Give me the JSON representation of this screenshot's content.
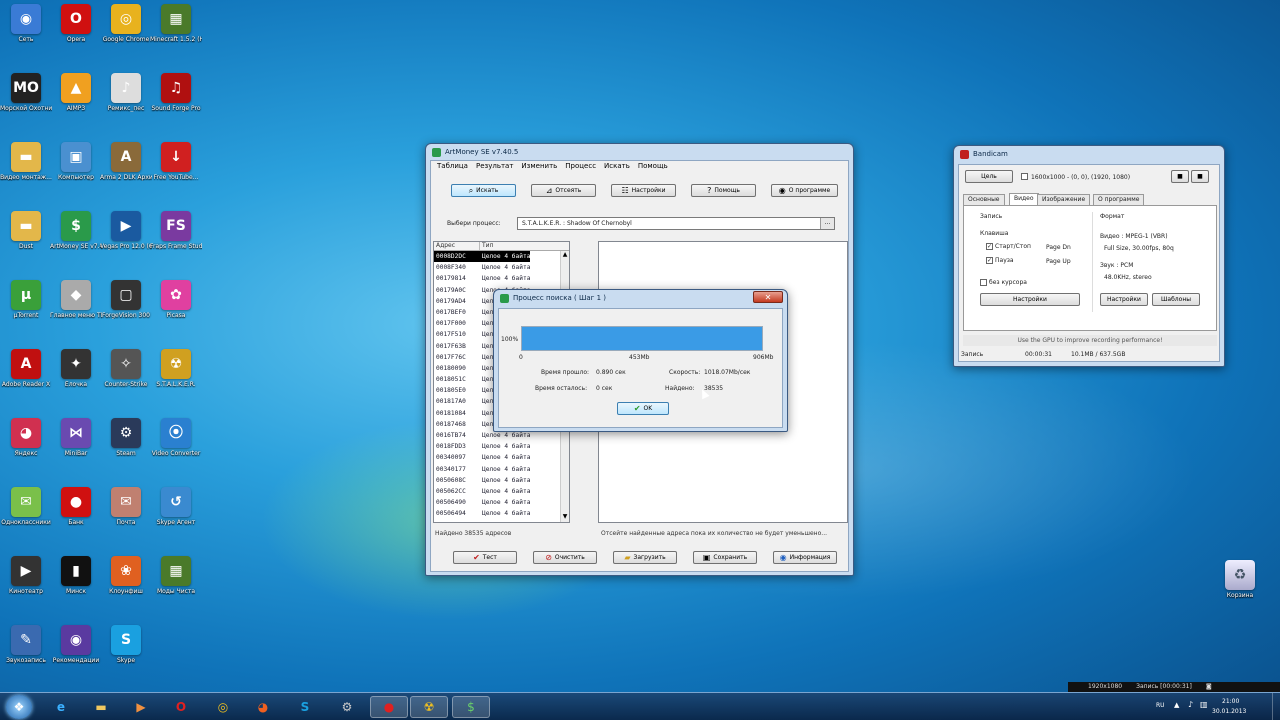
{
  "desktop_icons": [
    {
      "label": "Сеть",
      "icon": "network-icon",
      "color": "#3a7bd5",
      "glyph": "◉"
    },
    {
      "label": "Opera",
      "icon": "opera-icon",
      "color": "#d01010",
      "glyph": "O"
    },
    {
      "label": "Google Chrome",
      "icon": "chrome-icon",
      "color": "#e8b21e",
      "glyph": "◎"
    },
    {
      "label": "Minecraft 1.5.2 (Нет...",
      "icon": "minecraft-icon",
      "color": "#4a7a2a",
      "glyph": "▦"
    },
    {
      "label": "Морской Охотник",
      "icon": "game-icon",
      "color": "#222",
      "glyph": "MO"
    },
    {
      "label": "AIMP3",
      "icon": "aimp-icon",
      "color": "#f0a020",
      "glyph": "▲"
    },
    {
      "label": "Ремикс_пес",
      "icon": "file-icon",
      "color": "#ddd",
      "glyph": "♪"
    },
    {
      "label": "Sound Forge Pro",
      "icon": "soundforge-icon",
      "color": "#b01010",
      "glyph": "♫"
    },
    {
      "label": "Видео монтаж...",
      "icon": "folder-icon",
      "color": "#e3b74a",
      "glyph": "▬"
    },
    {
      "label": "Компьютер",
      "icon": "computer-icon",
      "color": "#4a90d0",
      "glyph": "▣"
    },
    {
      "label": "Arma 2 DLK Архив",
      "icon": "arma-icon",
      "color": "#8a6a3a",
      "glyph": "A"
    },
    {
      "label": "Free YouTube...",
      "icon": "youtube-icon",
      "color": "#d02020",
      "glyph": "↓"
    },
    {
      "label": "Dust",
      "icon": "folder-icon",
      "color": "#e3b74a",
      "glyph": "▬"
    },
    {
      "label": "ArtMoney SE v7.40.5",
      "icon": "artmoney-icon",
      "color": "#2a9a4a",
      "glyph": "$"
    },
    {
      "label": "Vegas Pro 12.0 (64-bit)",
      "icon": "vegas-icon",
      "color": "#1a5aa0",
      "glyph": "▶"
    },
    {
      "label": "Fraps Frame Studio",
      "icon": "fs-icon",
      "color": "#7a3aa0",
      "glyph": "FS"
    },
    {
      "label": "µTorrent",
      "icon": "utorrent-icon",
      "color": "#3aa03a",
      "glyph": "µ"
    },
    {
      "label": "Главное меню ТВ...",
      "icon": "app-icon",
      "color": "#aaa",
      "glyph": "◆"
    },
    {
      "label": "ForgeVision 300",
      "icon": "monitor-icon",
      "color": "#333",
      "glyph": "▢"
    },
    {
      "label": "Picasa",
      "icon": "picasa-icon",
      "color": "#e040a0",
      "glyph": "✿"
    },
    {
      "label": "Adobe Reader X",
      "icon": "pdf-icon",
      "color": "#c01010",
      "glyph": "A"
    },
    {
      "label": "Ёлочка",
      "icon": "game-icon",
      "color": "#333",
      "glyph": "✦"
    },
    {
      "label": "Counter-Strike",
      "icon": "cs-icon",
      "color": "#555",
      "glyph": "✧"
    },
    {
      "label": "S.T.A.L.K.E.R.",
      "icon": "stalker-icon",
      "color": "#d0a020",
      "glyph": "☢"
    },
    {
      "label": "Яндекс",
      "icon": "yandex-icon",
      "color": "#d03050",
      "glyph": "◕"
    },
    {
      "label": "MiniBar",
      "icon": "app-icon",
      "color": "#6a4ab0",
      "glyph": "⋈"
    },
    {
      "label": "Steam",
      "icon": "steam-icon",
      "color": "#2a3a5a",
      "glyph": "⚙"
    },
    {
      "label": "Video Converter",
      "icon": "video-icon",
      "color": "#2a80d0",
      "glyph": "⦿"
    },
    {
      "label": "Одноклассники",
      "icon": "app-icon",
      "color": "#7ac04a",
      "glyph": "✉"
    },
    {
      "label": "Банк",
      "icon": "app-icon",
      "color": "#d01010",
      "glyph": "●"
    },
    {
      "label": "Почта",
      "icon": "mail-icon",
      "color": "#c08070",
      "glyph": "✉"
    },
    {
      "label": "Skype Агент",
      "icon": "app-icon",
      "color": "#3a8ad0",
      "glyph": "↺"
    },
    {
      "label": "Кинотеатр",
      "icon": "app-icon",
      "color": "#333",
      "glyph": "▶"
    },
    {
      "label": "Минск",
      "icon": "app-icon",
      "color": "#111",
      "glyph": "▮"
    },
    {
      "label": "Клоунфиш",
      "icon": "app-icon",
      "color": "#e06020",
      "glyph": "❀"
    },
    {
      "label": "Моды Чиста",
      "icon": "minecraft-icon",
      "color": "#4a7a2a",
      "glyph": "▦"
    },
    {
      "label": "Звукозапись",
      "icon": "app-icon",
      "color": "#3a6ab0",
      "glyph": "✎"
    },
    {
      "label": "Рекомендации",
      "icon": "app-icon",
      "color": "#5a3aa0",
      "glyph": "◉"
    },
    {
      "label": "Skype",
      "icon": "skype-icon",
      "color": "#1aa0e0",
      "glyph": "S"
    }
  ],
  "recycle_bin": {
    "label": "Корзина",
    "icon": "recycle-bin-icon"
  },
  "artmoney": {
    "title": "ArtMoney SE v7.40.5",
    "menu": [
      "Таблица",
      "Результат",
      "Изменить",
      "Процесс",
      "Искать",
      "Помощь"
    ],
    "toolbar": [
      "Искать",
      "Отсеять",
      "Настройки",
      "Помощь",
      "О программе"
    ],
    "process_label": "Выбери процесс:",
    "process_value": "S.T.A.L.K.E.R. : Shadow Of Chernobyl",
    "columns": [
      "Адрес",
      "Тип"
    ],
    "rows": [
      {
        "addr": "0008D2DC",
        "type": "Целое 4 байта"
      },
      {
        "addr": "0008F340",
        "type": "Целое 4 байта"
      },
      {
        "addr": "00179814",
        "type": "Целое 4 байта"
      },
      {
        "addr": "00179A0C",
        "type": "Целое 4 байта"
      },
      {
        "addr": "00179AD4",
        "type": "Целое 4 байта"
      },
      {
        "addr": "0017BEF0",
        "type": "Целое 4 байта"
      },
      {
        "addr": "0017F000",
        "type": "Целое 4 байта"
      },
      {
        "addr": "0017F510",
        "type": "Целое 4 байта"
      },
      {
        "addr": "0017F63B",
        "type": "Целое 4 байта"
      },
      {
        "addr": "0017F76C",
        "type": "Целое 4 байта"
      },
      {
        "addr": "00180090",
        "type": "Целое 4 байта"
      },
      {
        "addr": "0018051C",
        "type": "Целое 4 байта"
      },
      {
        "addr": "001805E0",
        "type": "Целое 4 байта"
      },
      {
        "addr": "001817A0",
        "type": "Целое 4 байта"
      },
      {
        "addr": "00181084",
        "type": "Целое 4 байта"
      },
      {
        "addr": "00187468",
        "type": "Целое 4 байта"
      },
      {
        "addr": "0016TB74",
        "type": "Целое 4 байта"
      },
      {
        "addr": "0018FDD3",
        "type": "Целое 4 байта"
      },
      {
        "addr": "00340097",
        "type": "Целое 4 байта"
      },
      {
        "addr": "00340177",
        "type": "Целое 4 байта"
      },
      {
        "addr": "0050608C",
        "type": "Целое 4 байта"
      },
      {
        "addr": "005062CC",
        "type": "Целое 4 байта"
      },
      {
        "addr": "00506490",
        "type": "Целое 4 байта"
      },
      {
        "addr": "00506494",
        "type": "Целое 4 байта"
      }
    ],
    "status_left": "Найдено 38535 адресов",
    "status_right": "Отсейте найденные адреса пока их количество не будет уменьшено...",
    "bottom_buttons": [
      "Тест",
      "Очистить",
      "Загрузить",
      "Сохранить",
      "Информация"
    ]
  },
  "search_dialog": {
    "title": "Процесс поиска ( Шаг 1 )",
    "percent_label": "100%",
    "progress": 1.0,
    "scale": [
      "0",
      "453Mb",
      "906Mb"
    ],
    "elapsed_label": "Время прошло:",
    "elapsed_value": "0.890 сек",
    "speed_label": "Скорость:",
    "speed_value": "1018.07Mb/сек",
    "remaining_label": "Время осталось:",
    "remaining_value": "0 сек",
    "found_label": "Найдено:",
    "found_value": "38535",
    "ok_label": "OK"
  },
  "bandicam": {
    "title": "Bandicam",
    "target_button": "Цель",
    "target_value": "1600x1000 - (0, 0), (1920, 1080)",
    "tabs": [
      "Основные",
      "Видео",
      "Изображение",
      "О программе"
    ],
    "record_header": "Запись",
    "hotkey_header": "Клавиша",
    "start_stop_label": "Старт/Стоп",
    "start_stop_key": "Page Dn",
    "pause_label": "Пауза",
    "pause_key": "Page Up",
    "no_cursor_label": "без курсора",
    "settings_left": "Настройки",
    "format_header": "Формат",
    "video_format": "Видео : MPEG-1 (VBR)",
    "video_detail": "Full Size, 30.00fps, 80q",
    "audio_format": "Звук : PCM",
    "audio_detail": "48.0KHz, stereo",
    "settings_right": "Настройки",
    "templates": "Шаблоны",
    "gpu_hint": "Use the GPU to improve recording performance!",
    "status_label": "Запись",
    "status_time": "00:00:31",
    "status_size": "10.1MB / 637.5GB"
  },
  "taskbar": {
    "tray_lang": "RU",
    "time": "21:00",
    "date": "30.01.2013",
    "recording_overlay": "1920x1080",
    "recording_time": "Запись [00:00:31]"
  },
  "colors": {
    "progress": "#3a9be6",
    "selection": "#000000"
  }
}
